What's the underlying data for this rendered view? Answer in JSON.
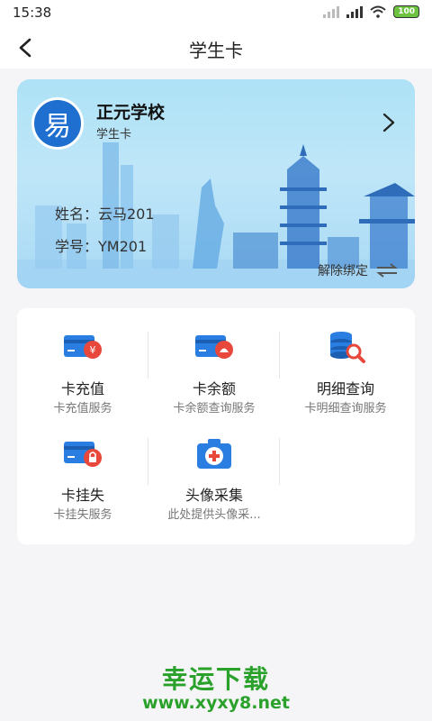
{
  "status_bar": {
    "time": "15:38",
    "battery": "100"
  },
  "header": {
    "title": "学生卡"
  },
  "card": {
    "school_name": "正元学校",
    "logo_text": "易",
    "card_type": "学生卡",
    "name_line": "姓名：云马201",
    "id_line": "学号：YM201",
    "unbind_label": "解除绑定"
  },
  "services": [
    {
      "label": "卡充值",
      "desc": "卡充值服务",
      "icon": "card-recharge-icon"
    },
    {
      "label": "卡余额",
      "desc": "卡余额查询服务",
      "icon": "card-balance-icon"
    },
    {
      "label": "明细查询",
      "desc": "卡明细查询服务",
      "icon": "details-search-icon"
    },
    {
      "label": "卡挂失",
      "desc": "卡挂失服务",
      "icon": "card-lock-icon"
    },
    {
      "label": "头像采集",
      "desc": "此处提供头像采...",
      "icon": "camera-icon"
    }
  ],
  "watermark": {
    "title": "幸运下载",
    "url": "www.xyxy8.net"
  },
  "colors": {
    "card_blue": "#aee2f6",
    "icon_blue": "#2a7de1",
    "icon_red": "#e8473c",
    "watermark_green": "#2aa12a"
  }
}
